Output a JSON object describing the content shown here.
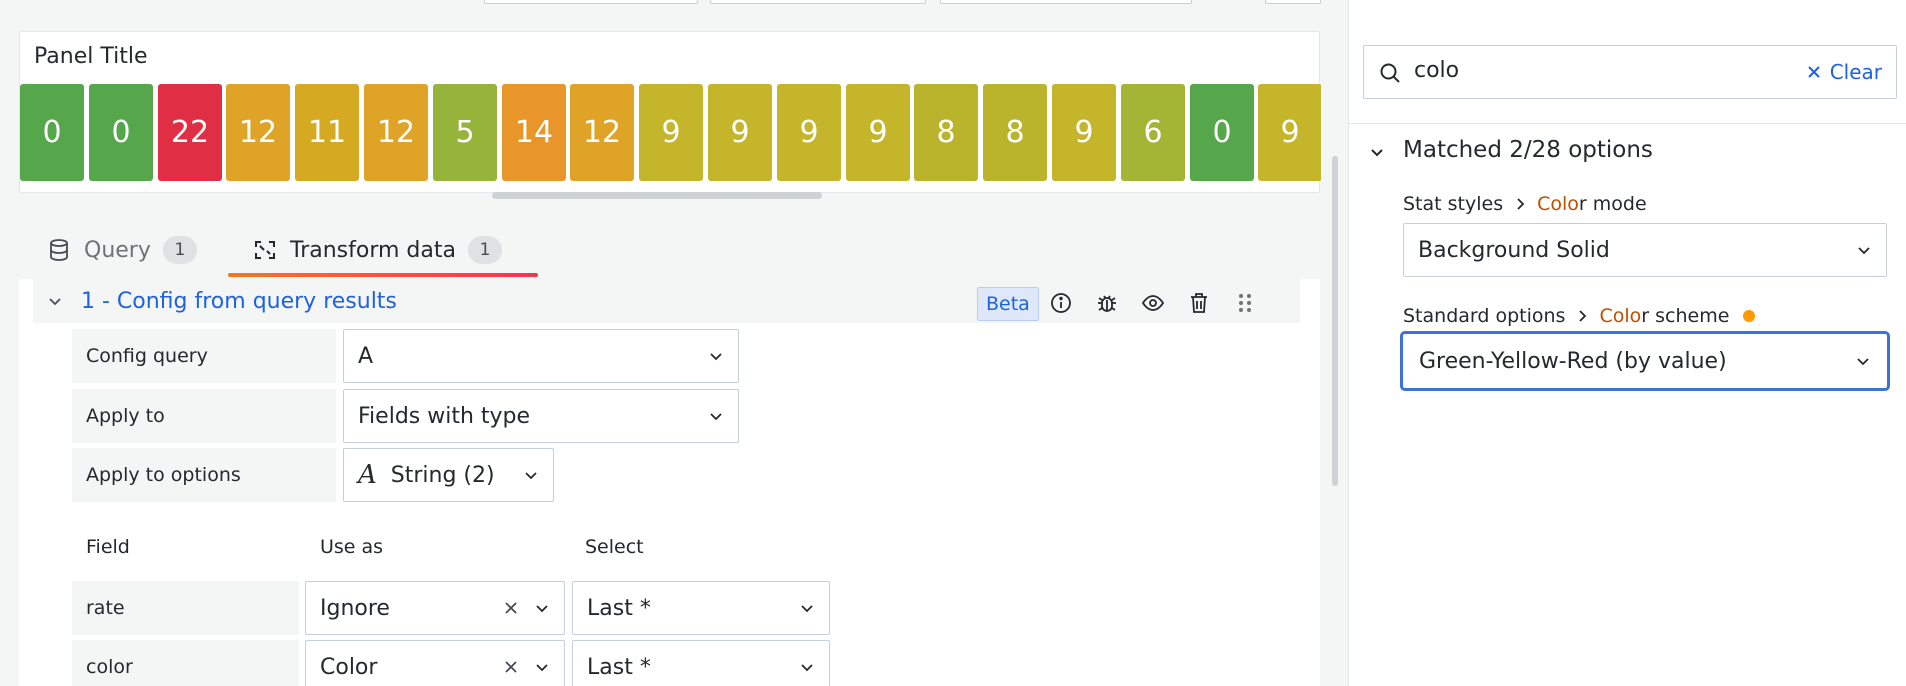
{
  "panel": {
    "title": "Panel Title",
    "cells": [
      {
        "value": "0",
        "color": "#56a64b"
      },
      {
        "value": "0",
        "color": "#56a64b"
      },
      {
        "value": "22",
        "color": "#e02f44"
      },
      {
        "value": "12",
        "color": "#dea327"
      },
      {
        "value": "11",
        "color": "#d6a923"
      },
      {
        "value": "12",
        "color": "#dea327"
      },
      {
        "value": "5",
        "color": "#96b33a"
      },
      {
        "value": "14",
        "color": "#e8962a"
      },
      {
        "value": "12",
        "color": "#dea327"
      },
      {
        "value": "9",
        "color": "#c4b52a"
      },
      {
        "value": "9",
        "color": "#c4b52a"
      },
      {
        "value": "9",
        "color": "#c4b52a"
      },
      {
        "value": "9",
        "color": "#c4b52a"
      },
      {
        "value": "8",
        "color": "#bab42d"
      },
      {
        "value": "8",
        "color": "#bab42d"
      },
      {
        "value": "9",
        "color": "#c4b52a"
      },
      {
        "value": "6",
        "color": "#a4b434"
      },
      {
        "value": "0",
        "color": "#56a64b"
      },
      {
        "value": "9",
        "color": "#c4b52a"
      }
    ]
  },
  "tabs": [
    {
      "label": "Query",
      "badge": "1"
    },
    {
      "label": "Transform data",
      "badge": "1"
    }
  ],
  "transformation": {
    "title": "1 - Config from query results",
    "beta": "Beta",
    "config_query_label": "Config query",
    "config_query_value": "A",
    "apply_to_label": "Apply to",
    "apply_to_value": "Fields with type",
    "apply_to_options_label": "Apply to options",
    "apply_to_options_value": "String (2)",
    "table_headers": {
      "field": "Field",
      "use_as": "Use as",
      "select": "Select"
    },
    "rows": [
      {
        "field": "rate",
        "use_as": "Ignore",
        "select": "Last *"
      },
      {
        "field": "color",
        "use_as": "Color",
        "select": "Last *"
      }
    ]
  },
  "options_pane": {
    "search_value": "colo",
    "clear_label": "Clear",
    "matched_label": "Matched 2/28 options",
    "option1": {
      "category": "Stat styles",
      "name_hl": "Colo",
      "name_rest": "r mode",
      "value": "Background Solid"
    },
    "option2": {
      "category": "Standard options",
      "name_hl": "Colo",
      "name_rest": "r scheme",
      "value": "Green-Yellow-Red (by value)"
    }
  },
  "colors": {
    "link_blue": "#1f62e0",
    "highlight_orange": "#c04f00",
    "modified_dot": "#ff9900",
    "focus_blue": "#3d71d9"
  }
}
